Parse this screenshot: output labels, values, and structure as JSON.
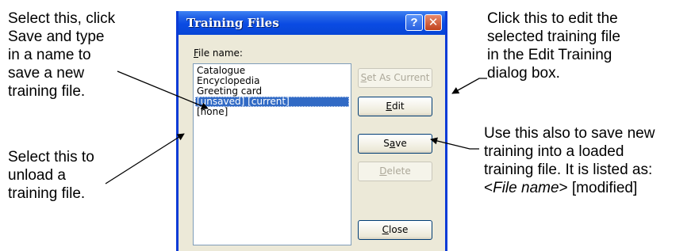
{
  "callouts": {
    "select_save": [
      "Select this, click",
      "Save and type",
      "in a name to",
      "save a new",
      "training file."
    ],
    "unload": [
      "Select this to",
      "unload a",
      "training file."
    ],
    "edit": [
      "Click this to edit the",
      "selected training file",
      "in the Edit Training",
      "dialog box."
    ],
    "save_new": {
      "lines": [
        "Use this also to save new",
        "training into a loaded",
        "training file. It is listed as:"
      ],
      "last_line": {
        "open": "<",
        "italic": "File name",
        "close": "> [modified]"
      }
    }
  },
  "dialog": {
    "title": "Training Files",
    "help_glyph": "?",
    "close_glyph": "✕",
    "file_label": {
      "mnemonic": "F",
      "rest": "ile name:"
    },
    "files": [
      {
        "label": "Catalogue",
        "selected": false
      },
      {
        "label": "Encyclopedia",
        "selected": false
      },
      {
        "label": "Greeting card",
        "selected": false
      },
      {
        "label": "[unsaved]  [current]",
        "selected": true
      },
      {
        "label": "[none]",
        "selected": false
      }
    ],
    "buttons": {
      "set_as_current": {
        "mnemonic": "S",
        "rest": "et As Current",
        "enabled": false
      },
      "edit": {
        "mnemonic": "E",
        "rest": "dit",
        "enabled": true
      },
      "save": {
        "pre": "S",
        "mnemonic": "a",
        "rest": "ve",
        "enabled": true
      },
      "delete": {
        "mnemonic": "D",
        "rest": "elete",
        "enabled": false
      },
      "close": {
        "mnemonic": "C",
        "rest": "lose",
        "enabled": true
      }
    }
  }
}
